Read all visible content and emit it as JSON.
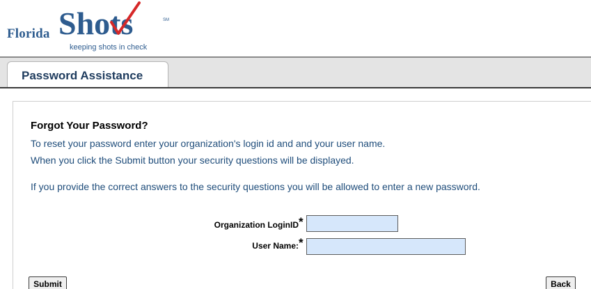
{
  "logo": {
    "florida": "Florida",
    "shots": "Shots",
    "sm": "SM",
    "tagline": "keeping shots in check",
    "brand_color": "#2e5c8f",
    "check_color": "#d62828"
  },
  "tab": {
    "label": "Password Assistance"
  },
  "main": {
    "heading": "Forgot Your Password?",
    "info_lines": [
      "To reset your password enter your organization's login id and and your user name.",
      "When you click the Submit button your security questions will be displayed.",
      "If you provide the correct answers to the security questions you will be allowed to enter a new password."
    ],
    "text_color": "#1e4c7a"
  },
  "form": {
    "org_label": "Organization LoginID",
    "user_label": "User Name:",
    "required_mark": "*",
    "org_value": "",
    "user_value": "",
    "field_color": "#d6e7fb"
  },
  "buttons": {
    "submit": "Submit",
    "back": "Back"
  }
}
